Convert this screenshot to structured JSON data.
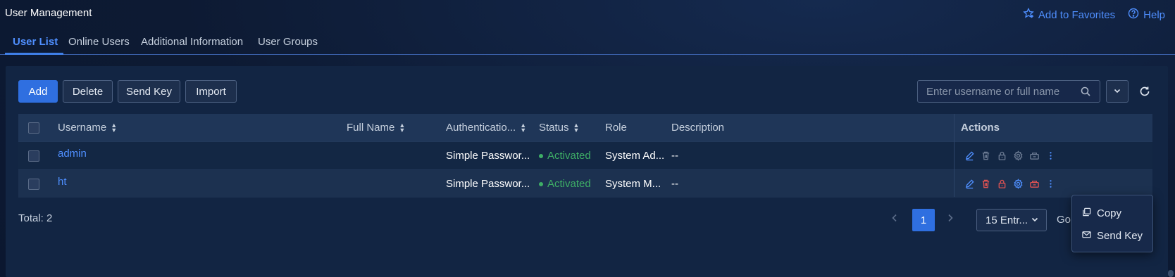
{
  "page": {
    "title": "User Management",
    "add_favorites_label": "Add to Favorites",
    "help_label": "Help"
  },
  "tabs": [
    {
      "label": "User List",
      "active": true
    },
    {
      "label": "Online Users",
      "active": false
    },
    {
      "label": "Additional Information",
      "active": false
    },
    {
      "label": "User Groups",
      "active": false
    }
  ],
  "toolbar": {
    "add_label": "Add",
    "delete_label": "Delete",
    "send_key_label": "Send Key",
    "import_label": "Import",
    "search_placeholder": "Enter username or full name"
  },
  "table": {
    "columns": [
      "Username",
      "Full Name",
      "Authenticatio...",
      "Status",
      "Role",
      "Description",
      "Actions"
    ],
    "rows": [
      {
        "username": "admin",
        "full_name": "",
        "auth": "Simple Passwor...",
        "status": "Activated",
        "role": "System Ad...",
        "description": "--"
      },
      {
        "username": "ht",
        "full_name": "",
        "auth": "Simple Passwor...",
        "status": "Activated",
        "role": "System M...",
        "description": "--"
      }
    ]
  },
  "pagination": {
    "total": "Total: 2",
    "current_page": "1",
    "per_page": "15 Entr...",
    "goto_label": "Go"
  },
  "context_menu": {
    "copy_label": "Copy",
    "send_key_label": "Send Key"
  },
  "colors": {
    "accent": "#2f6fe0",
    "link": "#4f8fff",
    "status_active": "#3eae66",
    "danger": "#e05252",
    "background": "#0d1a33"
  }
}
